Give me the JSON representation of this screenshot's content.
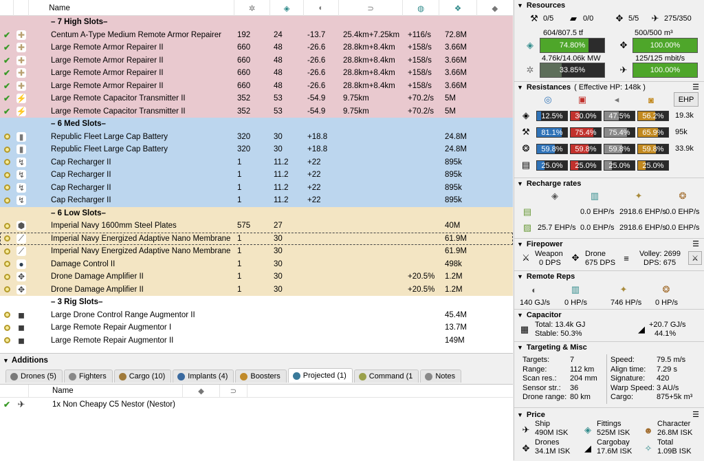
{
  "modules": {
    "columns": {
      "name": "Name"
    },
    "rows": [
      {
        "kind": "section",
        "rack": "high",
        "name": "– 7 High Slots–"
      },
      {
        "kind": "mod",
        "rack": "high",
        "state": "check",
        "icon": "armor-repairer-icon",
        "name": "Centum A-Type Medium Remote Armor Repairer",
        "cpu": "192",
        "pg": "24",
        "cap": "-13.7",
        "range": "25.4km+7.25km",
        "rep": "+116/s",
        "price": "72.8M"
      },
      {
        "kind": "mod",
        "rack": "high",
        "state": "check",
        "icon": "armor-repairer-icon",
        "name": "Large Remote Armor Repairer II",
        "cpu": "660",
        "pg": "48",
        "cap": "-26.6",
        "range": "28.8km+8.4km",
        "rep": "+158/s",
        "price": "3.66M"
      },
      {
        "kind": "mod",
        "rack": "high",
        "state": "check",
        "icon": "armor-repairer-icon",
        "name": "Large Remote Armor Repairer II",
        "cpu": "660",
        "pg": "48",
        "cap": "-26.6",
        "range": "28.8km+8.4km",
        "rep": "+158/s",
        "price": "3.66M"
      },
      {
        "kind": "mod",
        "rack": "high",
        "state": "check",
        "icon": "armor-repairer-icon",
        "name": "Large Remote Armor Repairer II",
        "cpu": "660",
        "pg": "48",
        "cap": "-26.6",
        "range": "28.8km+8.4km",
        "rep": "+158/s",
        "price": "3.66M"
      },
      {
        "kind": "mod",
        "rack": "high",
        "state": "check",
        "icon": "armor-repairer-icon",
        "name": "Large Remote Armor Repairer II",
        "cpu": "660",
        "pg": "48",
        "cap": "-26.6",
        "range": "28.8km+8.4km",
        "rep": "+158/s",
        "price": "3.66M"
      },
      {
        "kind": "mod",
        "rack": "high",
        "state": "check",
        "icon": "cap-transmitter-icon",
        "name": "Large Remote Capacitor Transmitter II",
        "cpu": "352",
        "pg": "53",
        "cap": "-54.9",
        "range": "9.75km",
        "rep": "+70.2/s",
        "price": "5M"
      },
      {
        "kind": "mod",
        "rack": "high",
        "state": "check",
        "icon": "cap-transmitter-icon",
        "name": "Large Remote Capacitor Transmitter II",
        "cpu": "352",
        "pg": "53",
        "cap": "-54.9",
        "range": "9.75km",
        "rep": "+70.2/s",
        "price": "5M"
      },
      {
        "kind": "section",
        "rack": "med",
        "name": "– 6 Med Slots–"
      },
      {
        "kind": "mod",
        "rack": "med",
        "state": "ring",
        "icon": "cap-battery-icon",
        "name": "Republic Fleet Large Cap Battery",
        "cpu": "320",
        "pg": "30",
        "cap": "+18.8",
        "range": "",
        "rep": "",
        "price": "24.8M"
      },
      {
        "kind": "mod",
        "rack": "med",
        "state": "ring",
        "icon": "cap-battery-icon",
        "name": "Republic Fleet Large Cap Battery",
        "cpu": "320",
        "pg": "30",
        "cap": "+18.8",
        "range": "",
        "rep": "",
        "price": "24.8M"
      },
      {
        "kind": "mod",
        "rack": "med",
        "state": "ring",
        "icon": "cap-recharger-icon",
        "name": "Cap Recharger II",
        "cpu": "1",
        "pg": "11.2",
        "cap": "+22",
        "range": "",
        "rep": "",
        "price": "895k"
      },
      {
        "kind": "mod",
        "rack": "med",
        "state": "ring",
        "icon": "cap-recharger-icon",
        "name": "Cap Recharger II",
        "cpu": "1",
        "pg": "11.2",
        "cap": "+22",
        "range": "",
        "rep": "",
        "price": "895k"
      },
      {
        "kind": "mod",
        "rack": "med",
        "state": "ring",
        "icon": "cap-recharger-icon",
        "name": "Cap Recharger II",
        "cpu": "1",
        "pg": "11.2",
        "cap": "+22",
        "range": "",
        "rep": "",
        "price": "895k"
      },
      {
        "kind": "mod",
        "rack": "med",
        "state": "ring",
        "icon": "cap-recharger-icon",
        "name": "Cap Recharger II",
        "cpu": "1",
        "pg": "11.2",
        "cap": "+22",
        "range": "",
        "rep": "",
        "price": "895k"
      },
      {
        "kind": "section",
        "rack": "low",
        "name": "– 6 Low Slots–"
      },
      {
        "kind": "mod",
        "rack": "low",
        "state": "ring",
        "icon": "armor-plate-icon",
        "name": "Imperial Navy 1600mm Steel Plates",
        "cpu": "575",
        "pg": "27",
        "cap": "",
        "range": "",
        "rep": "",
        "price": "40M"
      },
      {
        "kind": "mod",
        "rack": "low",
        "state": "ring",
        "icon": "nano-membrane-icon",
        "name": "Imperial Navy Energized Adaptive Nano Membrane",
        "cpu": "1",
        "pg": "30",
        "cap": "",
        "range": "",
        "rep": "",
        "price": "61.9M",
        "selected": true
      },
      {
        "kind": "mod",
        "rack": "low",
        "state": "ring",
        "icon": "nano-membrane-icon",
        "name": "Imperial Navy Energized Adaptive Nano Membrane",
        "cpu": "1",
        "pg": "30",
        "cap": "",
        "range": "",
        "rep": "",
        "price": "61.9M"
      },
      {
        "kind": "mod",
        "rack": "low",
        "state": "ring",
        "icon": "damage-control-icon",
        "name": "Damage Control II",
        "cpu": "1",
        "pg": "30",
        "cap": "",
        "range": "",
        "rep": "",
        "price": "498k"
      },
      {
        "kind": "mod",
        "rack": "low",
        "state": "ring",
        "icon": "drone-damage-icon",
        "name": "Drone Damage Amplifier II",
        "cpu": "1",
        "pg": "30",
        "cap": "",
        "range": "",
        "rep": "+20.5%",
        "price": "1.2M"
      },
      {
        "kind": "mod",
        "rack": "low",
        "state": "ring",
        "icon": "drone-damage-icon",
        "name": "Drone Damage Amplifier II",
        "cpu": "1",
        "pg": "30",
        "cap": "",
        "range": "",
        "rep": "+20.5%",
        "price": "1.2M"
      },
      {
        "kind": "section",
        "rack": "rig",
        "name": "– 3 Rig Slots–"
      },
      {
        "kind": "mod",
        "rack": "rig",
        "state": "ring",
        "icon": "rig-icon",
        "name": "Large Drone Control Range Augmentor II",
        "cpu": "",
        "pg": "",
        "cap": "",
        "range": "",
        "rep": "",
        "price": "45.4M"
      },
      {
        "kind": "mod",
        "rack": "rig",
        "state": "ring",
        "icon": "rig-icon",
        "name": "Large Remote Repair Augmentor I",
        "cpu": "",
        "pg": "",
        "cap": "",
        "range": "",
        "rep": "",
        "price": "13.7M"
      },
      {
        "kind": "mod",
        "rack": "rig",
        "state": "ring",
        "icon": "rig-icon",
        "name": "Large Remote Repair Augmentor II",
        "cpu": "",
        "pg": "",
        "cap": "",
        "range": "",
        "rep": "",
        "price": "149M"
      }
    ]
  },
  "additions": {
    "title": "Additions",
    "tabs": [
      "Drones (5)",
      "Fighters",
      "Cargo (10)",
      "Implants (4)",
      "Boosters",
      "Projected (1)",
      "Command (1",
      "Notes"
    ],
    "active_tab": 5,
    "table": {
      "name_header": "Name",
      "row_name": "1x Non Cheapy C5 Nestor (Nestor)"
    }
  },
  "resources": {
    "title": "Resources",
    "hardpoints": [
      "0/5",
      "0/0",
      "5/5",
      "275/350"
    ],
    "cpu_text": "604/807.5 tf",
    "cpu_pct": "74.80%",
    "cpu_fill": 74.8,
    "cargo_text": "500/500 m³",
    "cargo_pct": "100.00%",
    "cargo_fill": 100,
    "pg_text": "4.76k/14.06k MW",
    "pg_pct": "33.85%",
    "pg_fill": 33.85,
    "bw_text": "125/125 mbit/s",
    "bw_pct": "100.00%",
    "bw_fill": 100
  },
  "resistances": {
    "title": "Resistances",
    "subtitle": "( Effective HP: 148k )",
    "ehp_button": "EHP",
    "rows": [
      {
        "vals": [
          "12.5%",
          "30.0%",
          "47.5%",
          "56.2%"
        ],
        "fills": [
          12.5,
          30.0,
          47.5,
          56.2
        ],
        "ehp": "19.3k"
      },
      {
        "vals": [
          "81.1%",
          "75.4%",
          "75.4%",
          "65.9%"
        ],
        "fills": [
          81.1,
          75.4,
          75.4,
          65.9
        ],
        "ehp": "95k"
      },
      {
        "vals": [
          "59.8%",
          "59.8%",
          "59.8%",
          "59.8%"
        ],
        "fills": [
          59.8,
          59.8,
          59.8,
          59.8
        ],
        "ehp": "33.9k"
      },
      {
        "vals": [
          "25.0%",
          "25.0%",
          "25.0%",
          "25.0%"
        ],
        "fills": [
          25.0,
          25.0,
          25.0,
          25.0
        ],
        "ehp": ""
      }
    ],
    "colors": [
      "#2f73b8",
      "#c2312c",
      "#8a8a8a",
      "#c2891f"
    ]
  },
  "recharge": {
    "title": "Recharge rates",
    "row1": [
      "0.0 EHP/s",
      "2918.6 EHP/s",
      "0.0 EHP/s"
    ],
    "row2": [
      "25.7 EHP/s",
      "0.0 EHP/s",
      "2918.6 EHP/s",
      "0.0 EHP/s"
    ]
  },
  "firepower": {
    "title": "Firepower",
    "weapon_label": "Weapon",
    "weapon_dps": "0 DPS",
    "drone_label": "Drone",
    "drone_dps": "675 DPS",
    "volley": "Volley: 2699",
    "dps": "DPS: 675"
  },
  "remote_reps": {
    "title": "Remote Reps",
    "values": [
      "140 GJ/s",
      "0 HP/s",
      "746 HP/s",
      "0 HP/s"
    ]
  },
  "capacitor": {
    "title": "Capacitor",
    "total": "Total: 13.4k GJ",
    "stable": "Stable: 50.3%",
    "delta": "+20.7 GJ/s",
    "delta_pct": "44.1%"
  },
  "targeting": {
    "title": "Targeting & Misc",
    "left": [
      [
        "Targets:",
        "7"
      ],
      [
        "Range:",
        "112 km"
      ],
      [
        "Scan res.:",
        "204 mm"
      ],
      [
        "Sensor str.:",
        "36"
      ],
      [
        "Drone range:",
        "80 km"
      ]
    ],
    "right": [
      [
        "Speed:",
        "79.5 m/s"
      ],
      [
        "Align time:",
        "7.29 s"
      ],
      [
        "Signature:",
        "420"
      ],
      [
        "Warp Speed:",
        "3 AU/s"
      ],
      [
        "Cargo:",
        "875+5k m³"
      ]
    ]
  },
  "price": {
    "title": "Price",
    "ship_label": "Ship",
    "ship": "490M ISK",
    "fittings_label": "Fittings",
    "fittings": "525M ISK",
    "character_label": "Character",
    "character": "26.8M ISK",
    "drones_label": "Drones",
    "drones": "34.1M ISK",
    "cargobay_label": "Cargobay",
    "cargobay": "17.6M ISK",
    "total_label": "Total",
    "total": "1.09B ISK"
  }
}
